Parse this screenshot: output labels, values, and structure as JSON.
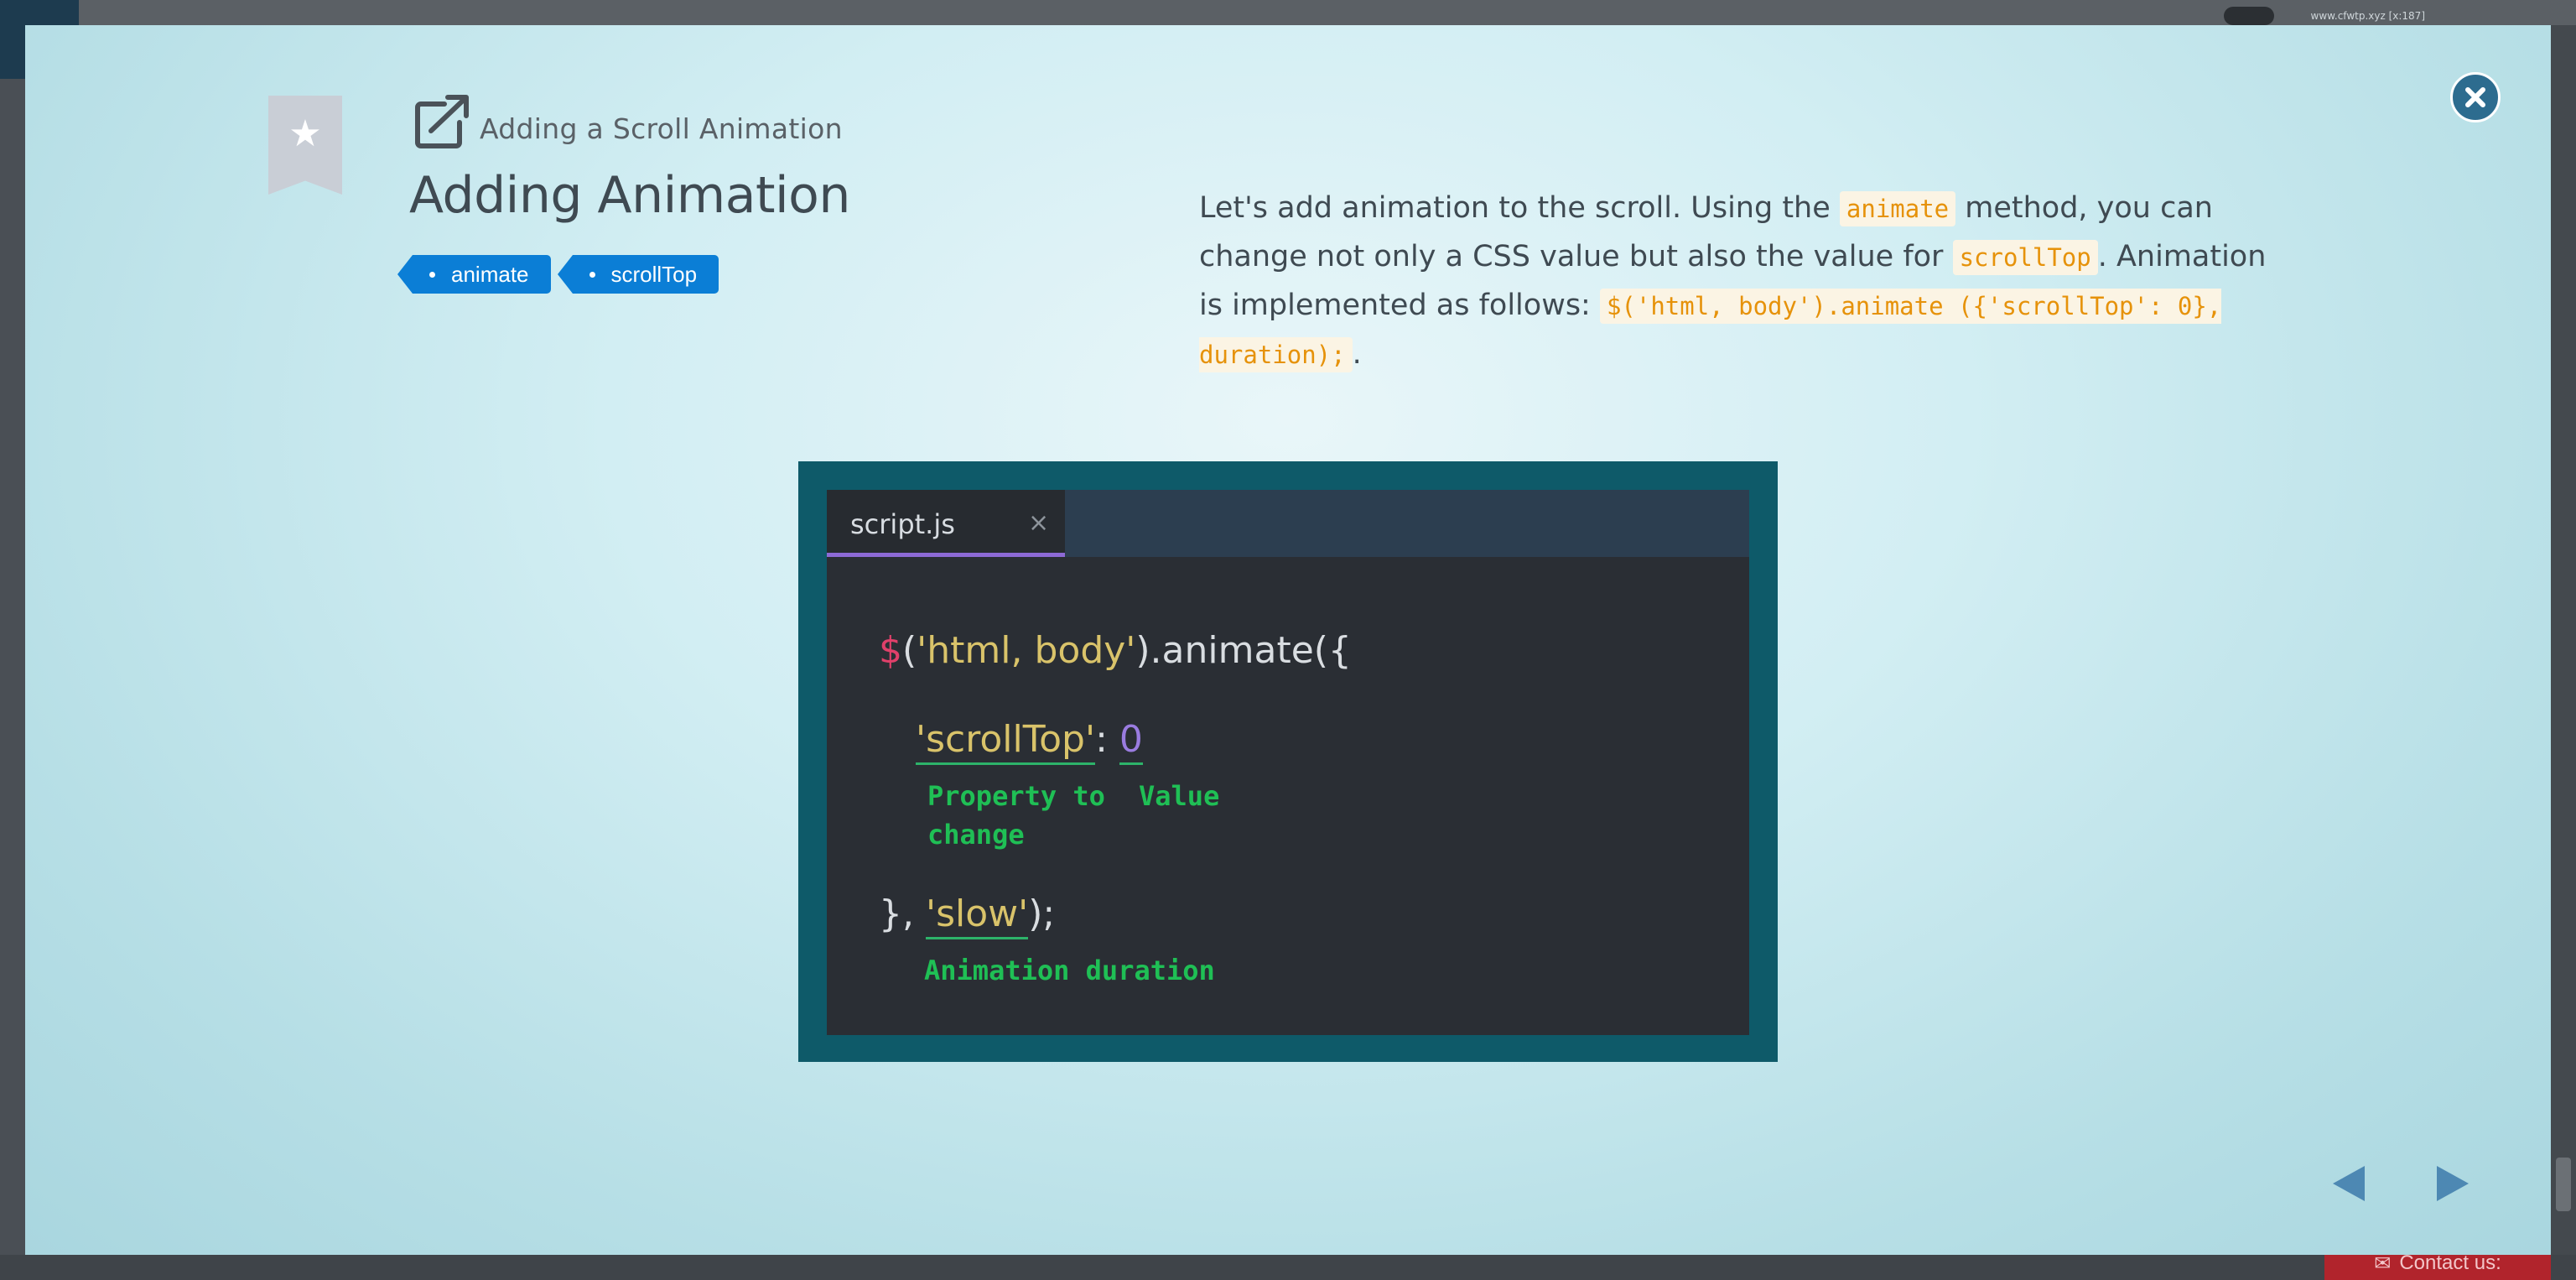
{
  "background": {
    "top_url": "www.cfwtp.xyz [x:187]",
    "contact_label": "Contact us:"
  },
  "header": {
    "subtitle": "Adding a Scroll Animation",
    "title": "Adding Animation",
    "tags": [
      "animate",
      "scrollTop"
    ]
  },
  "description": {
    "part1": "Let's add animation to the scroll. Using the ",
    "code1": "animate",
    "part2": " method, you can change not only a CSS value but also the value for ",
    "code2": "scrollTop",
    "part3": ". Animation is implemented as follows: ",
    "code3": "$('html, body').animate ({'scrollTop': 0}, duration);",
    "part4": "."
  },
  "editor": {
    "tab_label": "script.js",
    "tab_close": "×",
    "line1": {
      "dollar": "$",
      "open": "(",
      "str": "'html, body'",
      "rest": ").animate({"
    },
    "line2": {
      "key": "'scrollTop'",
      "colon": ": ",
      "value": "0"
    },
    "note_property_line1": "Property to",
    "note_property_line2": "change",
    "note_value": "Value",
    "line3": {
      "open": "}, ",
      "str": "'slow'",
      "rest": ");"
    },
    "note_duration": "Animation duration"
  },
  "icons": {
    "bookmark": "bookmark-star-icon",
    "external": "external-link-icon",
    "close": "close-circle-icon",
    "prev": "triangle-left-icon",
    "next": "triangle-right-icon"
  },
  "colors": {
    "tag_bg": "#0b7ed6",
    "code_accent": "#e6920a",
    "annotation_green": "#1fbf55",
    "close_btn": "#2d6c8f",
    "nav_arrow": "#4d88b3"
  }
}
